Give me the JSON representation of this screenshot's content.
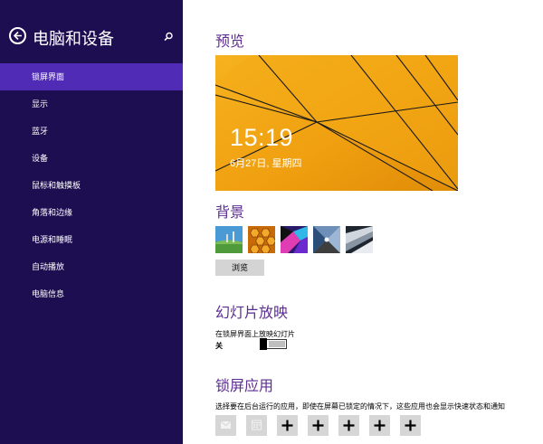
{
  "sidebar": {
    "title": "电脑和设备",
    "items": [
      {
        "label": "锁屏界面"
      },
      {
        "label": "显示"
      },
      {
        "label": "蓝牙"
      },
      {
        "label": "设备"
      },
      {
        "label": "鼠标和触摸板"
      },
      {
        "label": "角落和边缘"
      },
      {
        "label": "电源和睡眠"
      },
      {
        "label": "自动播放"
      },
      {
        "label": "电脑信息"
      }
    ],
    "active_index": 0
  },
  "preview": {
    "heading": "预览",
    "time": "15:19",
    "date": "6月27日, 星期四"
  },
  "background": {
    "heading": "背景",
    "thumbnails": [
      "landscape-thumbnail",
      "honeycomb-thumbnail",
      "colorful-thumbnail",
      "tunnel-thumbnail",
      "architecture-thumbnail"
    ],
    "browse_label": "浏览"
  },
  "slideshow": {
    "heading": "幻灯片放映",
    "description": "在锁屏界面上放映幻灯片",
    "toggle_state": "关",
    "toggle_on": false
  },
  "lock_apps": {
    "heading": "锁屏应用",
    "description": "选择要在后台运行的应用，即使在屏幕已锁定的情况下，这些应用也会显示快速状态和通知",
    "slots": [
      "mail-icon",
      "calendar-icon",
      "plus-icon",
      "plus-icon",
      "plus-icon",
      "plus-icon",
      "plus-icon"
    ]
  },
  "colors": {
    "sidebar_bg": "#1d0e52",
    "active_item_bg": "#4f2bb6",
    "heading": "#5c2d91",
    "preview_bg": "#f2a413"
  }
}
